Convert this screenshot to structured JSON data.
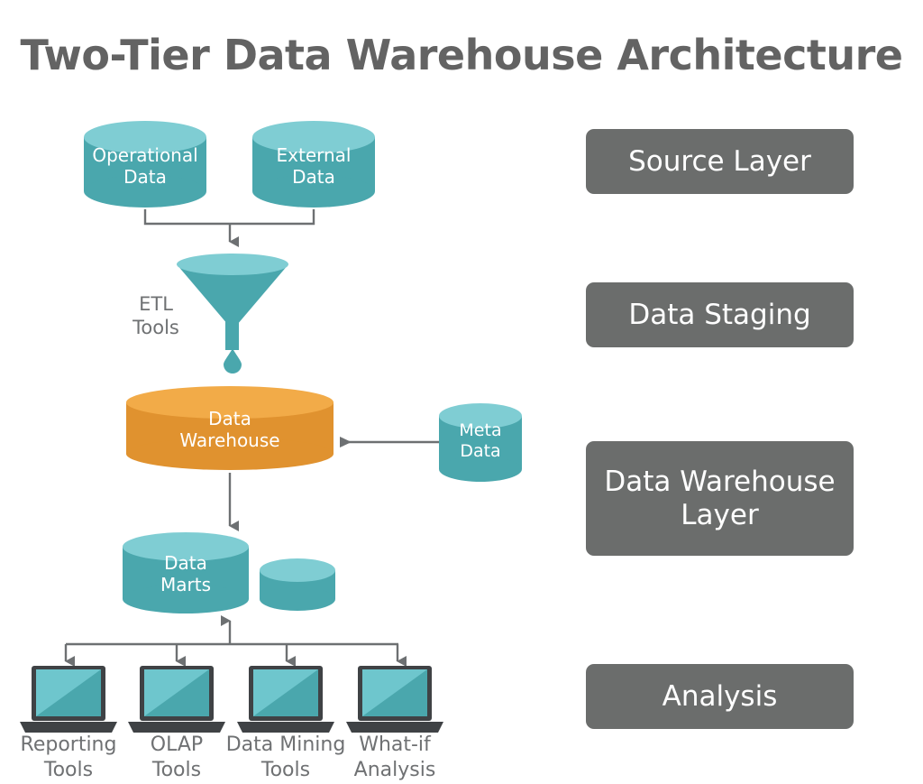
{
  "title": "Two-Tier Data Warehouse Architecture",
  "colors": {
    "teal_body": "#4aa7ad",
    "teal_top": "#7fcdd3",
    "orange_body": "#e0922f",
    "orange_top": "#f2ab48",
    "layer_box": "#6b6d6c",
    "gray_text": "#6f7173",
    "title_text": "#636363",
    "connector": "#6d7072",
    "laptop_frame": "#3f4245",
    "screen_light": "#6ec6cd",
    "screen_dark": "#4aa7ad",
    "background": "#ffffff"
  },
  "sources": [
    {
      "label_line1": "Operational",
      "label_line2": "Data",
      "name": "operational-data-cylinder"
    },
    {
      "label_line1": "External",
      "label_line2": "Data",
      "name": "external-data-cylinder"
    }
  ],
  "staging": {
    "etl_label_line1": "ETL",
    "etl_label_line2": "Tools",
    "icon": "funnel-icon"
  },
  "warehouse": {
    "label_line1": "Data",
    "label_line2": "Warehouse"
  },
  "metadata": {
    "label_line1": "Meta",
    "label_line2": "Data"
  },
  "data_marts": {
    "label_line1": "Data",
    "label_line2": "Marts"
  },
  "analysis_tools": [
    {
      "label_line1": "Reporting",
      "label_line2": "Tools",
      "name": "reporting-tools"
    },
    {
      "label_line1": "OLAP",
      "label_line2": "Tools",
      "name": "olap-tools"
    },
    {
      "label_line1": "Data Mining",
      "label_line2": "Tools",
      "name": "data-mining-tools"
    },
    {
      "label_line1": "What-if",
      "label_line2": "Analysis",
      "name": "what-if-analysis"
    }
  ],
  "layer_boxes": [
    {
      "line1": "Source Layer",
      "line2": "",
      "name": "layer-box-source-layer"
    },
    {
      "line1": "Data Staging",
      "line2": "",
      "name": "layer-box-data-staging"
    },
    {
      "line1": "Data Warehouse",
      "line2": "Layer",
      "name": "layer-box-data-warehouse-layer"
    },
    {
      "line1": "Analysis",
      "line2": "",
      "name": "layer-box-analysis"
    }
  ]
}
